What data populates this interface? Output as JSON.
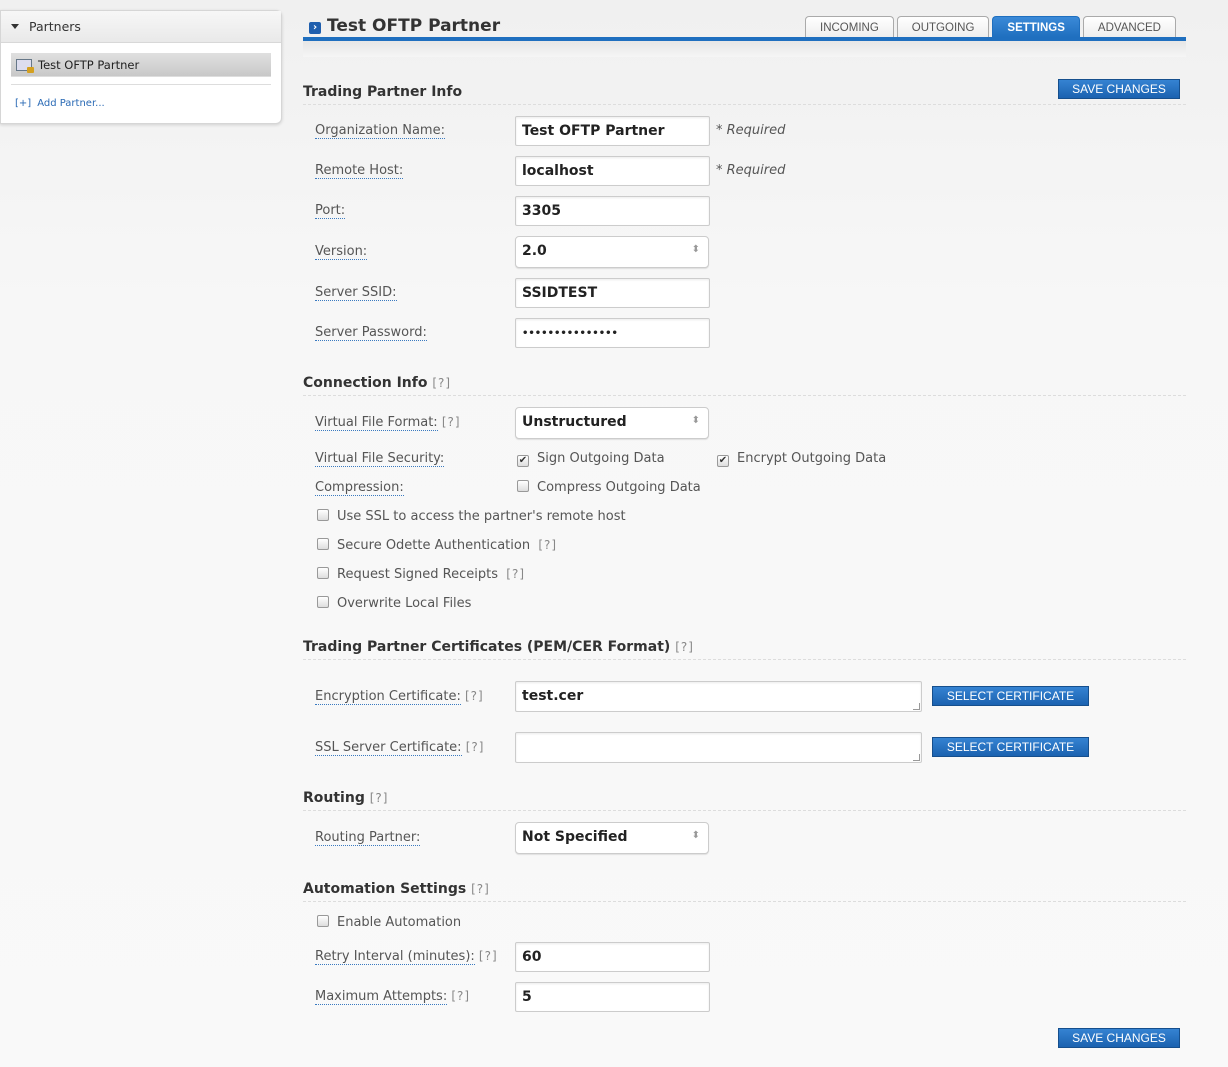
{
  "sidebar": {
    "header": "Partners",
    "items": [
      {
        "label": "Test OFTP Partner"
      }
    ],
    "add": "Add Partner...",
    "add_icon": "[+]"
  },
  "header": {
    "title": "Test OFTP Partner",
    "tabs": [
      "INCOMING",
      "OUTGOING",
      "SETTINGS",
      "ADVANCED"
    ],
    "active_tab": "SETTINGS"
  },
  "save_label": "SAVE CHANGES",
  "help": "[?]",
  "required": "* Required",
  "info": {
    "title": "Trading Partner Info",
    "org_label": "Organization Name:",
    "org": "Test OFTP Partner",
    "host_label": "Remote Host:",
    "host": "localhost",
    "port_label": "Port:",
    "port": "3305",
    "version_label": "Version:",
    "version": "2.0",
    "ssid_label": "Server SSID:",
    "ssid": "SSIDTEST",
    "pw_label": "Server Password:",
    "pw": "•••••••••••••••"
  },
  "conn": {
    "title": "Connection Info",
    "vff_label": "Virtual File Format:",
    "vff": "Unstructured",
    "vfs_label": "Virtual File Security:",
    "sign": "Sign Outgoing Data",
    "encrypt": "Encrypt Outgoing Data",
    "comp_label": "Compression:",
    "compress": "Compress Outgoing Data",
    "ssl": "Use SSL to access the partner's remote host",
    "soa": "Secure Odette Authentication",
    "rsr": "Request Signed Receipts",
    "olf": "Overwrite Local Files"
  },
  "certs": {
    "title": "Trading Partner Certificates (PEM/CER Format)",
    "enc_label": "Encryption Certificate:",
    "enc": "test.cer",
    "ssl_label": "SSL Server Certificate:",
    "ssl": "",
    "button": "SELECT CERTIFICATE"
  },
  "routing": {
    "title": "Routing",
    "label": "Routing Partner:",
    "value": "Not Specified"
  },
  "auto": {
    "title": "Automation Settings",
    "enable": "Enable Automation",
    "retry_label": "Retry Interval (minutes):",
    "retry": "60",
    "max_label": "Maximum Attempts:",
    "max": "5"
  }
}
